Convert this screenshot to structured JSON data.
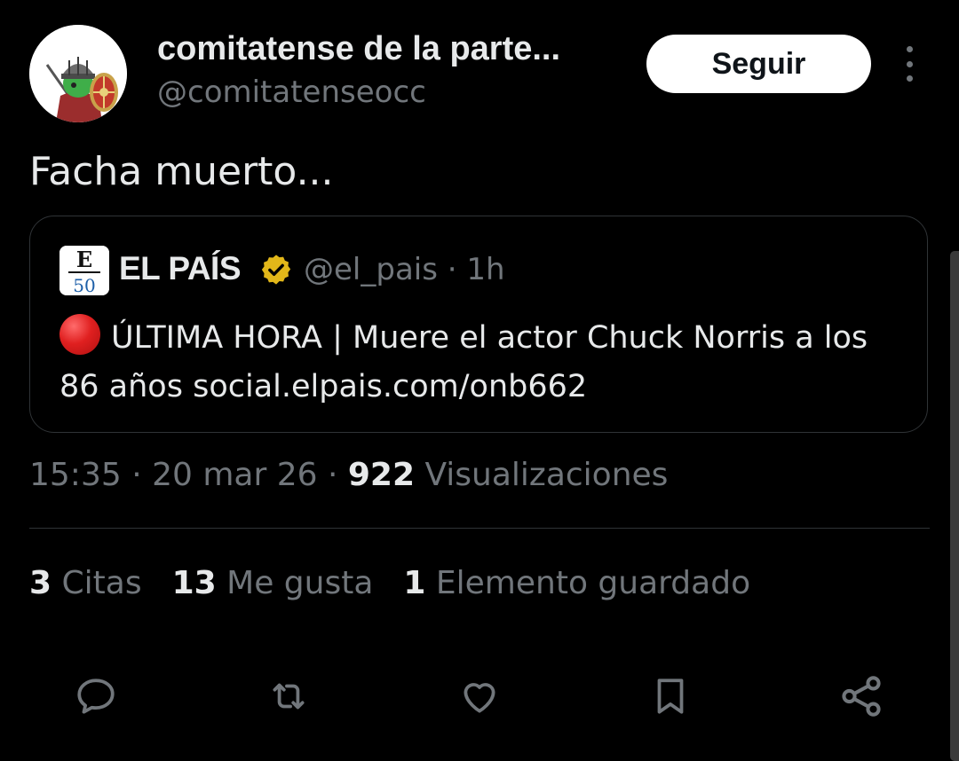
{
  "author": {
    "name": "comitatense de la parte...",
    "handle": "@comitatenseocc",
    "avatar_icon": "roman-soldier-shield-icon"
  },
  "follow_label": "Seguir",
  "tweet_text": "Facha muerto...",
  "quoted": {
    "avatar_letters": "E",
    "avatar_number": "50",
    "name": "EL PAÍS",
    "verified_color": "#e2b719",
    "handle_time": "@el_pais · 1h",
    "status_icon": "red-circle-icon",
    "body_text": "ÚLTIMA HORA |  Muere el actor Chuck Norris a los 86 años ",
    "link": "social.elpais.com/onb662"
  },
  "meta": {
    "time_date": "15:35 · 20 mar 26 · ",
    "views_count": "922",
    "views_label": " Visualizaciones"
  },
  "stats": {
    "quotes_count": "3",
    "quotes_label": " Citas",
    "likes_count": "13",
    "likes_label": " Me gusta",
    "saved_count": "1",
    "saved_label": " Elemento guardado"
  },
  "actions": [
    "reply-icon",
    "retweet-icon",
    "like-icon",
    "bookmark-icon",
    "share-icon"
  ],
  "colors": {
    "background": "#000000",
    "text": "#e7e9ea",
    "secondary": "#71767b",
    "border": "#2f3336"
  }
}
